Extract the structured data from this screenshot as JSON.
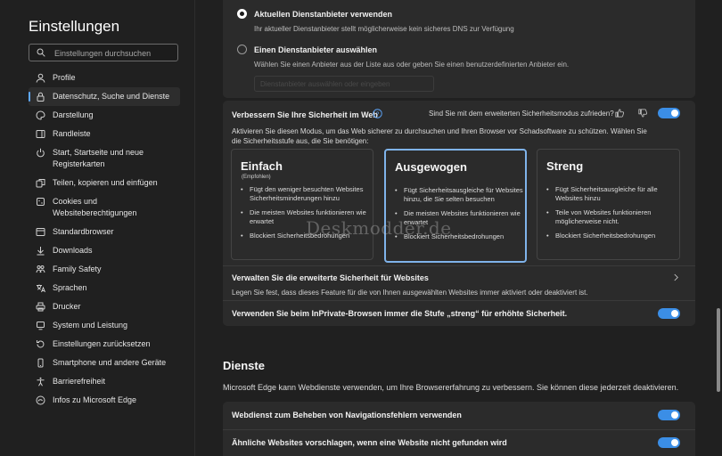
{
  "sidebar": {
    "title": "Einstellungen",
    "search_placeholder": "Einstellungen durchsuchen",
    "items": [
      {
        "label": "Profile",
        "icon": "profile-icon"
      },
      {
        "label": "Datenschutz, Suche und Dienste",
        "icon": "lock-icon",
        "selected": true
      },
      {
        "label": "Darstellung",
        "icon": "appearance-icon"
      },
      {
        "label": "Randleiste",
        "icon": "sidebar-icon"
      },
      {
        "label": "Start, Startseite und neue\nRegisterkarten",
        "icon": "power-icon"
      },
      {
        "label": "Teilen, kopieren und einfügen",
        "icon": "share-icon"
      },
      {
        "label": "Cookies und\nWebsiteberechtigungen",
        "icon": "cookie-icon"
      },
      {
        "label": "Standardbrowser",
        "icon": "browser-icon"
      },
      {
        "label": "Downloads",
        "icon": "download-icon"
      },
      {
        "label": "Family Safety",
        "icon": "family-icon"
      },
      {
        "label": "Sprachen",
        "icon": "language-icon"
      },
      {
        "label": "Drucker",
        "icon": "printer-icon"
      },
      {
        "label": "System und Leistung",
        "icon": "system-icon"
      },
      {
        "label": "Einstellungen zurücksetzen",
        "icon": "reset-icon"
      },
      {
        "label": "Smartphone und andere Geräte",
        "icon": "phone-icon"
      },
      {
        "label": "Barrierefreiheit",
        "icon": "accessibility-icon"
      },
      {
        "label": "Infos zu Microsoft Edge",
        "icon": "edge-icon"
      }
    ]
  },
  "dns": {
    "option1_title": "Aktuellen Dienstanbieter verwenden",
    "option1_desc": "Ihr aktueller Dienstanbieter stellt möglicherweise kein sicheres DNS zur Verfügung",
    "option2_title": "Einen Dienstanbieter auswählen",
    "option2_desc": "Wählen Sie einen Anbieter aus der Liste aus oder geben Sie einen benutzerdefinierten Anbieter ein.",
    "provider_input_placeholder": "Dienstanbieter auswählen oder eingeben"
  },
  "security": {
    "title": "Verbessern Sie Ihre Sicherheit im Web",
    "feedback_question": "Sind Sie mit dem erweiterten Sicherheitsmodus zufrieden?",
    "description": "Aktivieren Sie diesen Modus, um das Web sicherer zu durchsuchen und Ihren Browser vor Schadsoftware zu schützen. Wählen Sie die Sicherheitsstufe aus, die Sie benötigen:",
    "enabled": true,
    "levels": [
      {
        "title": "Einfach",
        "recommended": "(Empfohlen)",
        "bullets": [
          "Fügt den weniger besuchten Websites Sicherheitsminderungen hinzu",
          "Die meisten Websites funktionieren wie erwartet",
          "Blockiert Sicherheitsbedrohungen"
        ]
      },
      {
        "title": "Ausgewogen",
        "recommended": "",
        "selected": true,
        "bullets": [
          "Fügt Sicherheitsausgleiche für Websites hinzu, die Sie selten besuchen",
          "Die meisten Websites funktionieren wie erwartet",
          "Blockiert Sicherheitsbedrohungen"
        ]
      },
      {
        "title": "Streng",
        "recommended": "",
        "bullets": [
          "Fügt Sicherheitsausgleiche für alle Websites hinzu",
          "Teile von Websites funktionieren möglicherweise nicht.",
          "Blockiert Sicherheitsbedrohungen"
        ]
      }
    ],
    "manage_title": "Verwalten Sie die erweiterte Sicherheit für Websites",
    "manage_desc": "Legen Sie fest, dass dieses Feature für die von Ihnen ausgewählten Websites immer aktiviert oder deaktiviert ist.",
    "inprivate_label": "Verwenden Sie beim InPrivate-Browsen immer die Stufe „streng“ für erhöhte Sicherheit.",
    "inprivate_enabled": true
  },
  "services": {
    "heading": "Dienste",
    "description": "Microsoft Edge kann Webdienste verwenden, um Ihre Browsererfahrung zu verbessern. Sie können diese jederzeit deaktivieren.",
    "row1_label": "Webdienst zum Beheben von Navigationsfehlern verwenden",
    "row1_enabled": true,
    "row2_label": "Ähnliche Websites vorschlagen, wenn eine Website nicht gefunden wird",
    "row2_enabled": true
  },
  "watermark": "Deskmodder.de",
  "colors": {
    "accent": "#3b8ee6",
    "selected_border": "#7fb3ea",
    "background": "#202020",
    "card": "#2b2b2b"
  }
}
